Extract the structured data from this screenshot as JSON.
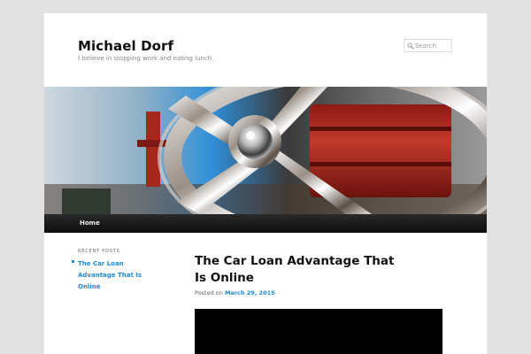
{
  "site": {
    "title": "Michael Dorf",
    "description": "I believe in stopping work and eating lunch."
  },
  "search": {
    "placeholder": "Search",
    "icon": "search-icon"
  },
  "nav": {
    "items": [
      {
        "label": "Home"
      }
    ]
  },
  "sidebar": {
    "heading": "RECENT POSTS",
    "recent_posts": [
      {
        "label": "The Car Loan Advantage That Is Online"
      }
    ]
  },
  "post": {
    "title": "The Car Loan Advantage That Is Online",
    "posted_on_label": "Posted on",
    "date": "March 29, 2015"
  },
  "colors": {
    "link": "#1b8be0",
    "nav_bg": "#111111",
    "page_bg": "#e2e2e2"
  }
}
